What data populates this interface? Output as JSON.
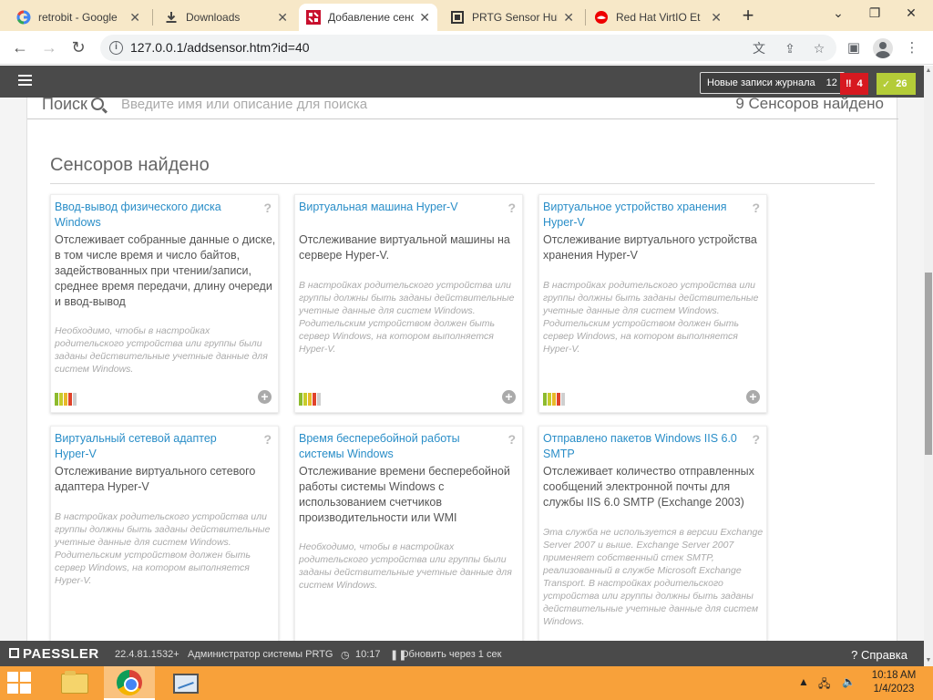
{
  "browser": {
    "tabs": [
      {
        "title": "retrobit - Google",
        "icon": "google-icon",
        "active": false
      },
      {
        "title": "Downloads",
        "icon": "download-icon",
        "active": false
      },
      {
        "title": "Добавление сенс",
        "icon": "prtg-icon",
        "active": true
      },
      {
        "title": "PRTG Sensor Hub",
        "icon": "prtg-hub-icon",
        "active": false
      },
      {
        "title": "Red Hat VirtIO Et",
        "icon": "redhat-icon",
        "active": false
      }
    ],
    "url": "127.0.0.1/addsensor.htm?id=40"
  },
  "header": {
    "log_label": "Новые записи журнала",
    "log_count": "12",
    "alarm_count": "4",
    "ok_count": "26",
    "colors": {
      "alarm": "#d71920",
      "ok": "#b4cc38",
      "bar": "#4a4a4a"
    }
  },
  "search": {
    "label": "Поиск",
    "placeholder": "Введите имя или описание для поиска",
    "found_text": "9 Сенсоров найдено"
  },
  "section": {
    "title": "Сенсоров найдено"
  },
  "cards": [
    {
      "title": "Ввод-вывод физического диска Windows",
      "desc": "Отслеживает собранные данные о диске, в том числе время и число байтов, задействованных при чтении/записи, среднее время передачи, длину очереди и ввод-вывод",
      "note": "Необходимо, чтобы в настройках родительского устройства или группы были заданы действительные учетные данные для систем Windows.",
      "help": "?"
    },
    {
      "title": "Виртуальная машина Hyper-V",
      "desc": "Отслеживание виртуальной машины на сервере Hyper-V.",
      "note": "В настройках родительского устройства или группы должны быть заданы действительные учетные данные для систем Windows. Родительским устройством должен быть сервер Windows, на котором выполняется Hyper-V.",
      "help": "?"
    },
    {
      "title": "Виртуальное устройство хранения Hyper-V",
      "desc": "Отслеживание виртуального устройства хранения Hyper-V",
      "note": "В настройках родительского устройства или группы должны быть заданы действительные учетные данные для систем Windows. Родительским устройством должен быть сервер Windows, на котором выполняется Hyper-V.",
      "help": "?"
    },
    {
      "title": "Виртуальный сетевой адаптер Hyper-V",
      "desc": "Отслеживание виртуального сетевого адаптера Hyper-V",
      "note": "В настройках родительского устройства или группы должны быть заданы действительные учетные данные для систем Windows. Родительским устройством должен быть сервер Windows, на котором выполняется Hyper-V.",
      "help": "?"
    },
    {
      "title": "Время бесперебойной работы системы Windows",
      "desc": "Отслеживание времени бесперебойной работы системы Windows с использованием счетчиков производительности или WMI",
      "note": "Необходимо, чтобы в настройках родительского устройства или группы были заданы действительные учетные данные для систем Windows.",
      "help": "?"
    },
    {
      "title": "Отправлено пакетов Windows IIS 6.0 SMTP",
      "desc": "Отслеживает количество отправленных сообщений электронной почты для службы IIS 6.0 SMTP (Exchange 2003)",
      "note": "Эта служба не используется в версии Exchange Server 2007 и выше. Exchange Server 2007 применяет собственный стек SMTP, реализованный в службе Microsoft Exchange Transport. В настройках родительского устройства или группы должны быть заданы действительные учетные данные для систем Windows.",
      "help": "?"
    }
  ],
  "perf_colors": [
    "#8dbb2e",
    "#c7cc2b",
    "#e8b92b",
    "#e0432b",
    "#cfcfcf"
  ],
  "footer": {
    "brand": "PAESSLER",
    "version": "22.4.81.1532+",
    "user": "Администратор системы PRTG",
    "time": "10:17",
    "refresh": "Обновить через 1 сек",
    "help": "Справка"
  },
  "taskbar": {
    "clock_time": "10:18 AM",
    "clock_date": "1/4/2023"
  }
}
